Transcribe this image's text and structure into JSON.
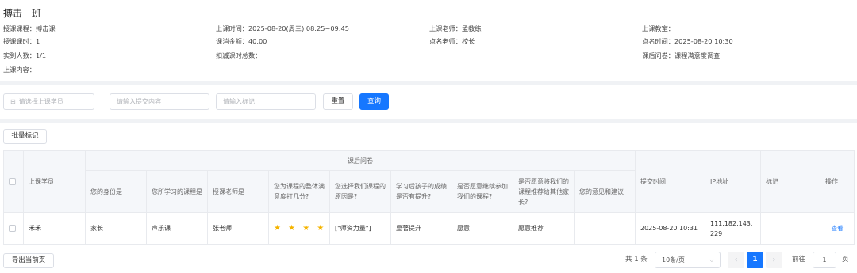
{
  "class_title": "搏击一班",
  "info": {
    "course": "授课课程：搏击课",
    "lesson_time": "上课时间：2025-08-20(周三) 08:25~09:45",
    "teacher": "上课老师：孟教练",
    "classroom": "上课教室：",
    "lesson_hours": "授课课时：1",
    "fee": "课消金额：40.00",
    "roll_teacher": "点名老师：校长",
    "roll_time": "点名时间：2025-08-20 10:30",
    "attendance": "实到人数：1/1",
    "deduct_total": "扣减课时总数：",
    "survey": "课后问卷：课程满意度调查",
    "content": "上课内容："
  },
  "filter": {
    "student_placeholder": "请选择上课学员",
    "content_placeholder": "请输入提交内容",
    "mark_placeholder": "请输入标记",
    "reset_label": "重置",
    "query_label": "查询"
  },
  "batch_mark_label": "批量标记",
  "table": {
    "group_header": "课后问卷",
    "headers": {
      "student": "上课学员",
      "q1": "您的身份是",
      "q2": "您所学习的课程是",
      "q3": "授课老师是",
      "q4": "您为课程的整体满意度打几分?",
      "q5": "您选择我们课程的原因是?",
      "q6": "学习后孩子的成绩是否有提升?",
      "q7": "是否愿意继续参加我们的课程?",
      "q8": "是否愿意将我们的课程推荐给其他家长?",
      "q9": "您的意见和建议",
      "submit_time": "提交时间",
      "ip": "IP地址",
      "mark": "标记",
      "action": "操作"
    },
    "rows": [
      {
        "student": "禾禾",
        "q1": "家长",
        "q2": "声乐课",
        "q3": "张老师",
        "q4_stars": "★ ★ ★ ★ ★",
        "q4_score": 5,
        "q5": "[\"师资力量\"]",
        "q6": "显著提升",
        "q7": "愿意",
        "q8": "愿意推荐",
        "q9": "",
        "submit_time": "2025-08-20 10:31",
        "ip": "111.182.143.229",
        "mark": "",
        "action": "查看"
      }
    ]
  },
  "footer": {
    "export_label": "导出当前页",
    "total": "共 1 条",
    "page_size": "10条/页",
    "prev_icon": "‹",
    "current_page": "1",
    "next_icon": "›",
    "goto_label": "前往",
    "goto_value": "1",
    "page_unit": "页"
  },
  "colors": {
    "primary": "#1677ff",
    "star": "#f5b400"
  }
}
